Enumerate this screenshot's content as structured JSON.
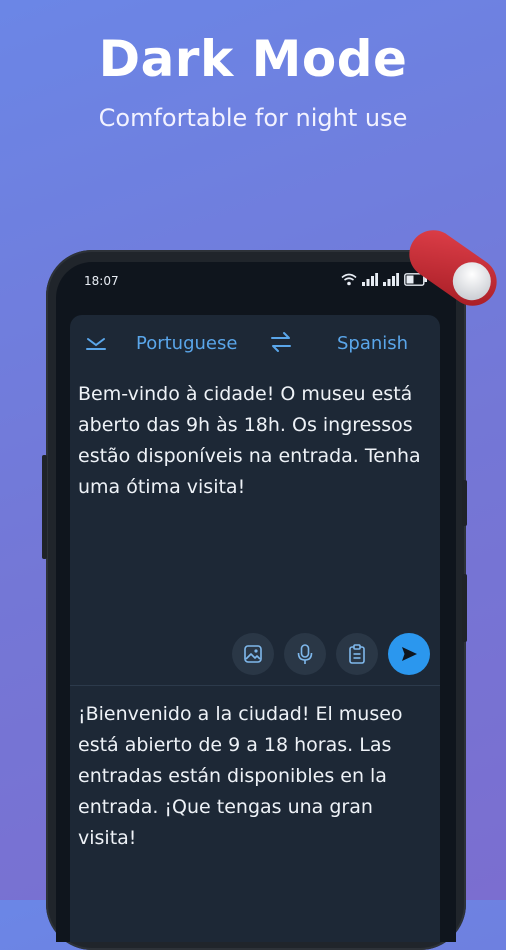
{
  "promo": {
    "title": "Dark Mode",
    "subtitle": "Comfortable for night use"
  },
  "status_bar": {
    "time": "18:07",
    "battery": "39"
  },
  "translator": {
    "source_language": "Portuguese",
    "target_language": "Spanish",
    "source_text": "Bem-vindo à cidade! O museu está aberto das 9h às 18h. Os ingressos estão disponíveis na entrada. Tenha uma ótima visita!",
    "translated_text": "¡Bienvenido a la ciudad! El museo está abierto de 9 a 18 horas. Las entradas están disponibles en la entrada. ¡Que tengas una gran visita!"
  },
  "icons": [
    "collapse-chevron-icon",
    "swap-icon",
    "image-icon",
    "microphone-icon",
    "clipboard-icon",
    "send-icon",
    "wifi-icon",
    "signal-icon",
    "battery-icon"
  ],
  "colors": {
    "background": "#7477d6",
    "accent": "#5aa6ea",
    "send_button": "#2b97ee",
    "card": "#1d2836",
    "toggle": "#c0262e"
  }
}
